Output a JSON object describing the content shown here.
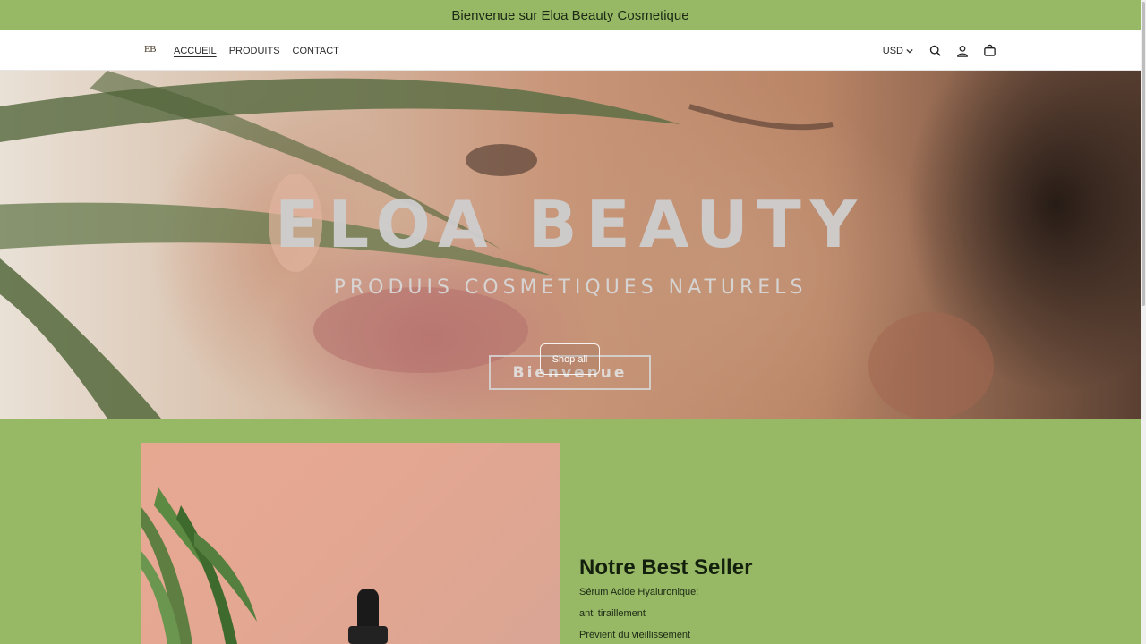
{
  "announcement": "Bienvenue sur Eloa Beauty Cosmetique",
  "header": {
    "logo": "EB",
    "nav": [
      {
        "label": "ACCUEIL",
        "active": true
      },
      {
        "label": "PRODUITS",
        "active": false
      },
      {
        "label": "CONTACT",
        "active": false
      }
    ],
    "currency": "USD",
    "icons": [
      "search-icon",
      "account-icon",
      "cart-icon"
    ]
  },
  "hero": {
    "title": "ELOA BEAUTY",
    "subtitle": "PRODUIS COSMETIQUES NATURELS",
    "box_text": "Bienvenue",
    "button_label": "Shop all"
  },
  "featured": {
    "title": "Notre Best Seller",
    "lines": [
      "Sérum Acide Hyaluronique:",
      "anti tiraillement",
      "Prévient du vieillissement"
    ]
  },
  "colors": {
    "accent_green": "#97b864",
    "header_bg": "#ffffff",
    "text_dark": "#14200e"
  }
}
